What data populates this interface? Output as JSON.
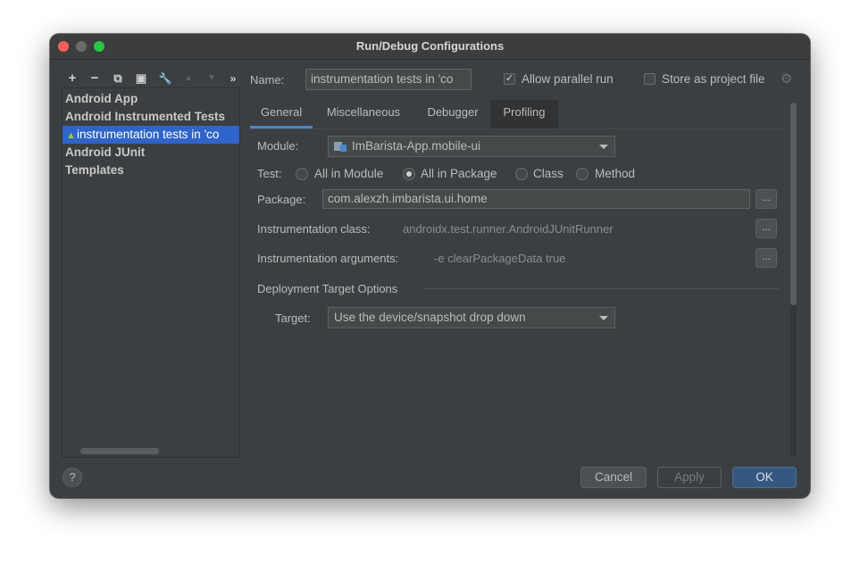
{
  "window": {
    "title": "Run/Debug Configurations"
  },
  "toolbar": {
    "add": "+",
    "remove": "−",
    "copy": "⧉",
    "save": "▣",
    "edit": "🔧",
    "up": "▲",
    "down": "▼",
    "more": "»"
  },
  "tree": {
    "items": [
      {
        "label": "Android App"
      },
      {
        "label": "Android Instrumented Tests"
      },
      {
        "label": "instrumentation tests in 'co",
        "selected": true
      },
      {
        "label": "Android JUnit"
      },
      {
        "label": "Templates"
      }
    ]
  },
  "header": {
    "name_label": "Name:",
    "name_value": "instrumentation tests in 'co",
    "allow_parallel_label": "Allow parallel run",
    "allow_parallel_checked": true,
    "store_label": "Store as project file",
    "store_checked": false
  },
  "tabs": [
    {
      "label": "General",
      "active": true
    },
    {
      "label": "Miscellaneous"
    },
    {
      "label": "Debugger"
    },
    {
      "label": "Profiling"
    }
  ],
  "general": {
    "module_label": "Module:",
    "module_value": "ImBarista-App.mobile-ui",
    "test_label": "Test:",
    "test_options": [
      "All in Module",
      "All in Package",
      "Class",
      "Method"
    ],
    "test_selected": "All in Package",
    "package_label": "Package:",
    "package_value": "com.alexzh.imbarista.ui.home",
    "instr_class_label": "Instrumentation class:",
    "instr_class_value": "androidx.test.runner.AndroidJUnitRunner",
    "instr_args_label": "Instrumentation arguments:",
    "instr_args_value": "-e clearPackageData true",
    "browse": "...",
    "deploy_section": "Deployment Target Options",
    "target_label": "Target:",
    "target_value": "Use the device/snapshot drop down"
  },
  "footer": {
    "help": "?",
    "cancel": "Cancel",
    "apply": "Apply",
    "ok": "OK"
  },
  "colors": {
    "background": "#3c3f41",
    "selection": "#2f65ca",
    "ok_button": "#365880",
    "tab_underline": "#4a88c7"
  }
}
